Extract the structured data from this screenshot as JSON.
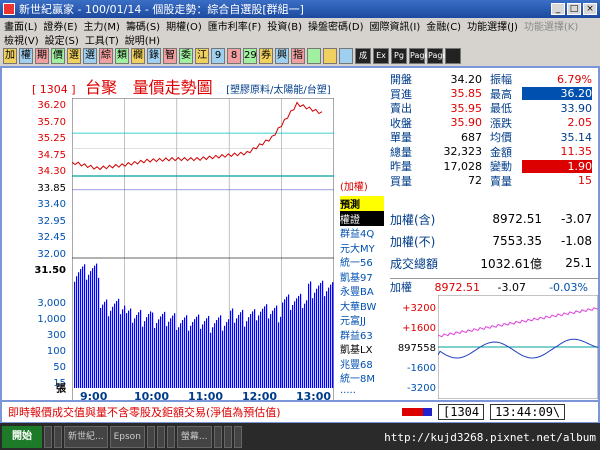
{
  "window": {
    "title": "新世紀贏家 - 100/01/14 - 個股走勢：綜合自選股[群組一]",
    "buttons": [
      "_",
      "□",
      "×"
    ]
  },
  "menu": {
    "row1": [
      "畫面(L)",
      "證券(E)",
      "主力(M)",
      "籌碼(S)",
      "期權(O)",
      "匯市利率(F)",
      "投資(B)",
      "操盤密碼(D)",
      "國際資訊(I)",
      "金融(C)",
      "功能選擇(J)",
      "功能選擇(K)"
    ],
    "row1_disabled": [
      11
    ],
    "row2": [
      "檢視(V)",
      "設定(S)",
      "工具(T)",
      "說明(H)"
    ]
  },
  "toolbar": {
    "buttons": [
      "加",
      "權",
      "期",
      "價",
      "選",
      "選",
      "綜",
      "類",
      "欄",
      "錄",
      "智",
      "委",
      "江",
      "9",
      "8",
      "29",
      "券",
      "興",
      "指",
      "",
      "",
      "",
      "成",
      "Ex",
      "Pg",
      "Page",
      "Page",
      ""
    ]
  },
  "stock": {
    "code": "[ 1304 ]",
    "name": "台聚",
    "chart_title": "量價走勢圖",
    "industry": "[塑膠原料/太陽能/台塑]"
  },
  "price_axis": [
    "36.20",
    "35.70",
    "35.25",
    "34.75",
    "34.30",
    "33.85",
    "33.40",
    "32.95",
    "32.45",
    "32.00",
    "31.50"
  ],
  "volume_axis": [
    "3,000",
    "1,000",
    "300",
    "100",
    "50",
    "15"
  ],
  "volume_unit": "張",
  "time_axis": [
    "9:00",
    "10:00",
    "11:00",
    "12:00",
    "13:00"
  ],
  "brokers": {
    "header": "(加權)",
    "items": [
      "預測",
      "權證",
      "群益4Q",
      "元大MY",
      "統一56",
      "凱基97",
      "永豐BA",
      "大華BW",
      "元富JJ",
      "群益63",
      "凱基LX",
      "兆豐68",
      "統一8M",
      "....."
    ]
  },
  "quote": {
    "rows": [
      {
        "l": "開盤",
        "v": "34.20",
        "l2": "振幅",
        "v2": "6.79%"
      },
      {
        "l": "買進",
        "v": "35.85",
        "l2": "最高",
        "v2": "36.20"
      },
      {
        "l": "賣出",
        "v": "35.95",
        "l2": "最低",
        "v2": "33.90"
      },
      {
        "l": "收盤",
        "v": "35.90",
        "l2": "漲跌",
        "v2": "2.05"
      },
      {
        "l": "單量",
        "v": "687",
        "l2": "均價",
        "v2": "35.14"
      },
      {
        "l": "總量",
        "v": "32,323",
        "l2": "金額",
        "v2": "11.35"
      },
      {
        "l": "昨量",
        "v": "17,028",
        "l2": "變動",
        "v2": "1.90"
      },
      {
        "l": "買量",
        "v": "72",
        "l2": "賣量",
        "v2": "15"
      }
    ]
  },
  "index": {
    "rows": [
      {
        "l": "加權(含)",
        "v": "8972.51",
        "c": "-3.07"
      },
      {
        "l": "加權(不)",
        "v": "7553.35",
        "c": "-1.08"
      },
      {
        "l": "成交總額",
        "v": "1032.61億",
        "c": "25.1"
      }
    ]
  },
  "mini": {
    "label": "加權",
    "value": "8972.51",
    "change": "-3.07",
    "pct": "-0.03%",
    "axis": [
      "+3200",
      "+1600",
      "897558",
      "-1600",
      "-3200"
    ]
  },
  "status": {
    "message": "即時報價成交值與量不含零股及鉅額交易(淨值為預估值)",
    "code": "[1304",
    "time": "13:44:09\\"
  },
  "taskbar": {
    "start": "開始",
    "tasks": [
      "",
      "",
      "新世紀...",
      "Epson",
      "",
      "",
      "",
      "螢幕...",
      "",
      "",
      ""
    ]
  },
  "watermark": "http://kujd3268.pixnet.net/album",
  "chart_data": {
    "type": "line",
    "x": [
      "9:00",
      "9:30",
      "10:00",
      "10:30",
      "11:00",
      "11:30",
      "12:00",
      "12:30",
      "13:00",
      "13:15",
      "13:30"
    ],
    "series": [
      {
        "values": [
          34.3,
          34.1,
          34.2,
          34.35,
          34.4,
          34.4,
          34.5,
          34.6,
          35.1,
          36.2,
          35.9
        ]
      }
    ],
    "ylim": [
      31.5,
      36.2
    ],
    "volume": [
      3000,
      300,
      150,
      120,
      100,
      100,
      150,
      200,
      400,
      1000,
      800
    ]
  },
  "colors": {
    "up": "#d00000",
    "axis_blue": "#003c8a",
    "chart_line": "#d00000",
    "volume": "#0000ff",
    "cyan_band": "#00c0c0"
  }
}
